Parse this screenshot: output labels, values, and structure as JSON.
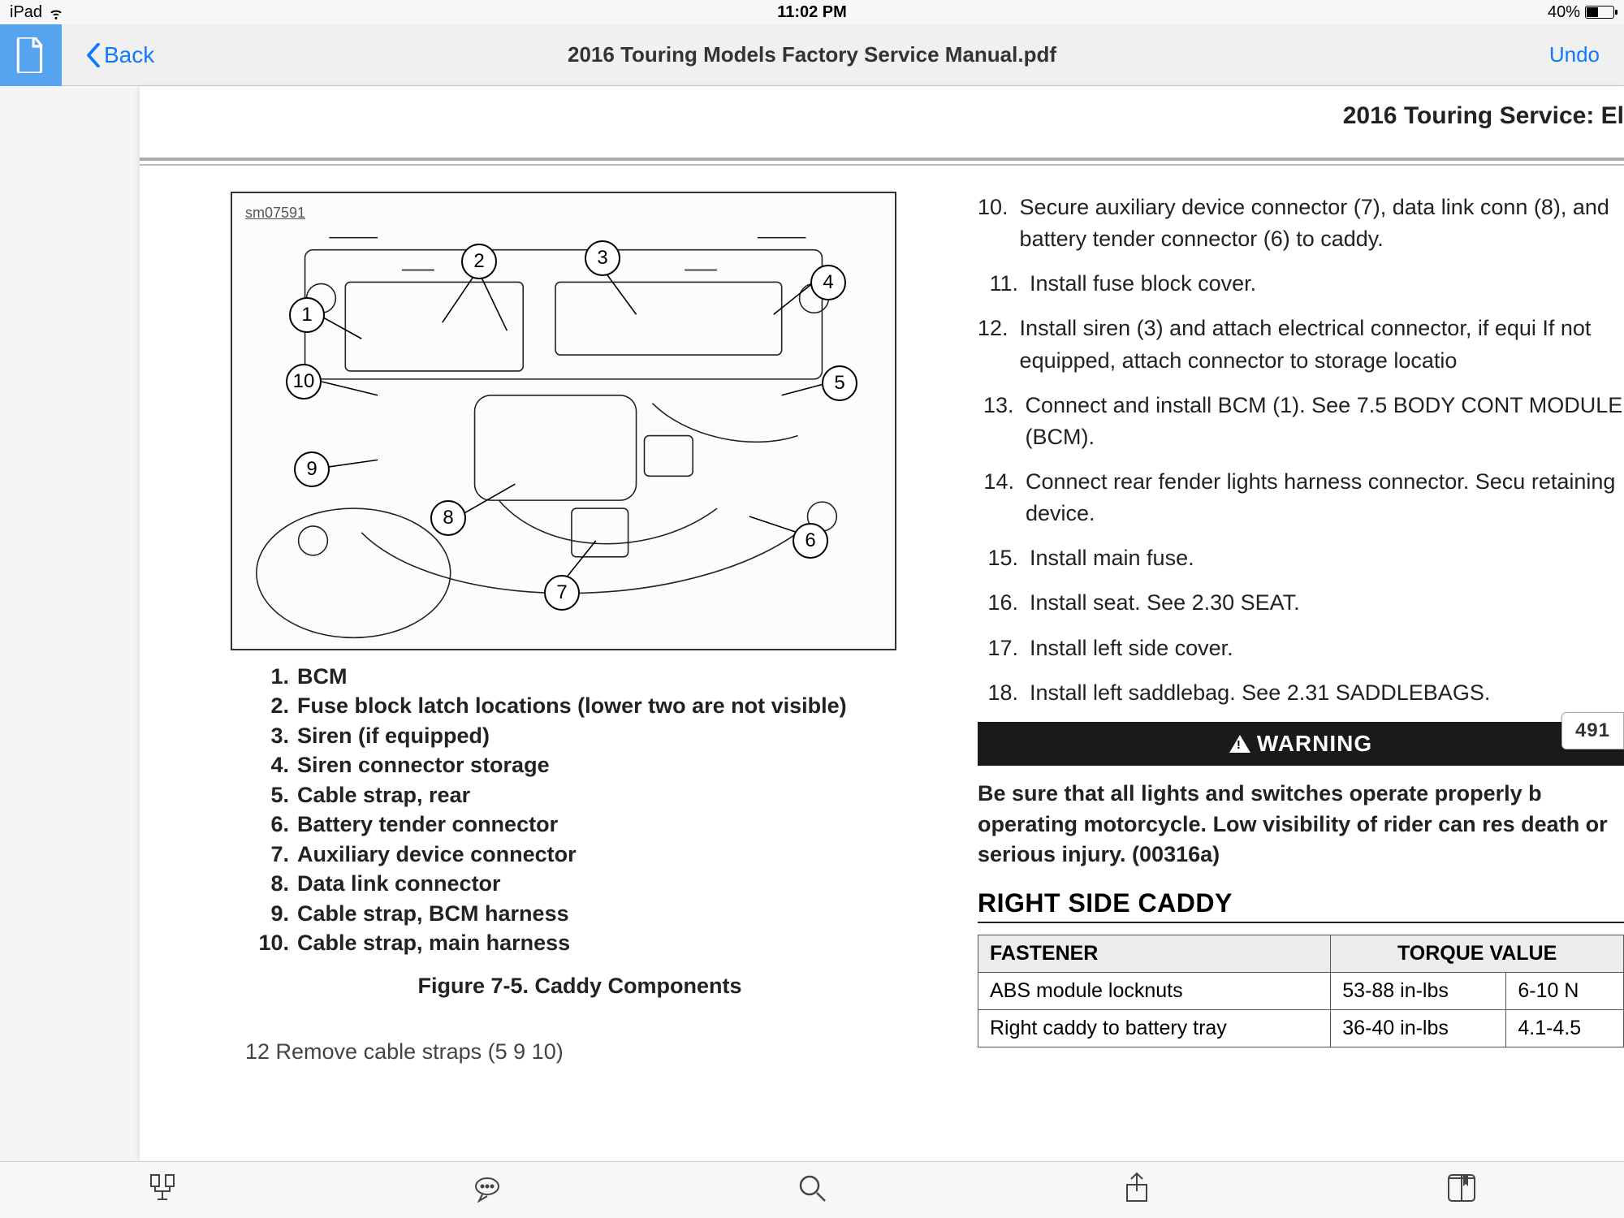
{
  "statusbar": {
    "device": "iPad",
    "time": "11:02 PM",
    "battery_pct": "40%"
  },
  "toolbar": {
    "back_label": "Back",
    "title": "2016 Touring Models Factory Service Manual.pdf",
    "undo_label": "Undo"
  },
  "doc": {
    "running_head": "2016 Touring Service:  El",
    "figure": {
      "id": "sm07591",
      "caption": "Figure 7-5. Caddy Components",
      "callouts": [
        "1",
        "2",
        "3",
        "4",
        "5",
        "6",
        "7",
        "8",
        "9",
        "10"
      ],
      "legend": [
        {
          "n": "1.",
          "t": "BCM"
        },
        {
          "n": "2.",
          "t": "Fuse block latch locations (lower two are not visible)"
        },
        {
          "n": "3.",
          "t": "Siren (if equipped)"
        },
        {
          "n": "4.",
          "t": "Siren connector storage"
        },
        {
          "n": "5.",
          "t": "Cable strap, rear"
        },
        {
          "n": "6.",
          "t": "Battery tender connector"
        },
        {
          "n": "7.",
          "t": "Auxiliary device connector"
        },
        {
          "n": "8.",
          "t": "Data link connector"
        },
        {
          "n": "9.",
          "t": "Cable strap, BCM harness"
        },
        {
          "n": "10.",
          "t": "Cable strap, main harness"
        }
      ]
    },
    "cutoff_line": "12   Remove cable straps (5  9  10)",
    "steps": [
      {
        "n": "10.",
        "t": "Secure auxiliary device connector (7), data link conn (8), and battery tender connector (6) to caddy."
      },
      {
        "n": "11.",
        "t": "Install fuse block cover."
      },
      {
        "n": "12.",
        "t": "Install siren (3) and attach electrical connector, if equi If not equipped, attach connector to storage locatio"
      },
      {
        "n": "13.",
        "t": "Connect and install BCM (1). See 7.5 BODY CONT MODULE (BCM)."
      },
      {
        "n": "14.",
        "t": "Connect rear fender lights harness connector. Secu retaining device."
      },
      {
        "n": "15.",
        "t": "Install main fuse."
      },
      {
        "n": "16.",
        "t": "Install seat. See 2.30 SEAT."
      },
      {
        "n": "17.",
        "t": "Install left side cover."
      },
      {
        "n": "18.",
        "t": "Install left saddlebag. See 2.31 SADDLEBAGS."
      }
    ],
    "warning_label": "WARNING",
    "page_number": "491",
    "warning_text": "Be sure that all lights and switches operate properly b operating motorcycle. Low visibility of rider can res death or serious injury. (00316a)",
    "section_heading": "RIGHT SIDE CADDY",
    "table": {
      "headers": [
        "FASTENER",
        "TORQUE VALUE"
      ],
      "rows": [
        [
          "ABS module locknuts",
          "53-88 in-lbs",
          "6-10 N"
        ],
        [
          "Right caddy to battery tray",
          "36-40 in-lbs",
          "4.1-4.5 "
        ]
      ]
    }
  }
}
